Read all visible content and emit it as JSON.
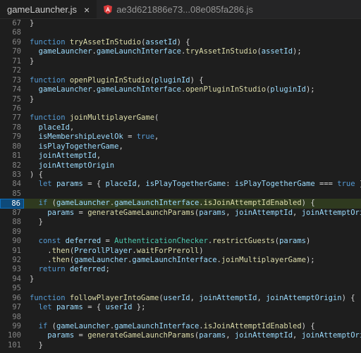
{
  "tabs": [
    {
      "label": "gameLauncher.js",
      "active": true
    },
    {
      "label": "ae3d621886e73...08e085fa286.js",
      "active": false
    }
  ],
  "close_glyph": "×",
  "highlighted_line": 86,
  "lines": [
    {
      "n": "67",
      "t": [
        [
          "}",
          "br"
        ]
      ]
    },
    {
      "n": "68",
      "t": []
    },
    {
      "n": "69",
      "t": [
        [
          "function ",
          "kw"
        ],
        [
          "tryAssetInStudio",
          "fn"
        ],
        [
          "(",
          "br"
        ],
        [
          "assetId",
          "var"
        ],
        [
          ") {",
          "br"
        ]
      ]
    },
    {
      "n": "70",
      "t": [
        [
          "  ",
          "br"
        ],
        [
          "gameLauncher",
          "var"
        ],
        [
          ".",
          "br"
        ],
        [
          "gameLaunchInterface",
          "var"
        ],
        [
          ".",
          "br"
        ],
        [
          "tryAssetInStudio",
          "fn"
        ],
        [
          "(",
          "br"
        ],
        [
          "assetId",
          "var"
        ],
        [
          ");",
          "br"
        ]
      ]
    },
    {
      "n": "71",
      "t": [
        [
          "}",
          "br"
        ]
      ]
    },
    {
      "n": "72",
      "t": []
    },
    {
      "n": "73",
      "t": [
        [
          "function ",
          "kw"
        ],
        [
          "openPluginInStudio",
          "fn"
        ],
        [
          "(",
          "br"
        ],
        [
          "pluginId",
          "var"
        ],
        [
          ") {",
          "br"
        ]
      ]
    },
    {
      "n": "74",
      "t": [
        [
          "  ",
          "br"
        ],
        [
          "gameLauncher",
          "var"
        ],
        [
          ".",
          "br"
        ],
        [
          "gameLaunchInterface",
          "var"
        ],
        [
          ".",
          "br"
        ],
        [
          "openPluginInStudio",
          "fn"
        ],
        [
          "(",
          "br"
        ],
        [
          "pluginId",
          "var"
        ],
        [
          ");",
          "br"
        ]
      ]
    },
    {
      "n": "75",
      "t": [
        [
          "}",
          "br"
        ]
      ]
    },
    {
      "n": "76",
      "t": []
    },
    {
      "n": "77",
      "t": [
        [
          "function ",
          "kw"
        ],
        [
          "joinMultiplayerGame",
          "fn"
        ],
        [
          "(",
          "br"
        ]
      ]
    },
    {
      "n": "78",
      "t": [
        [
          "  ",
          "br"
        ],
        [
          "placeId",
          "var"
        ],
        [
          ",",
          "br"
        ]
      ]
    },
    {
      "n": "79",
      "t": [
        [
          "  ",
          "br"
        ],
        [
          "isMembershipLevelOk",
          "var"
        ],
        [
          " = ",
          "br"
        ],
        [
          "true",
          "kw"
        ],
        [
          ",",
          "br"
        ]
      ]
    },
    {
      "n": "80",
      "t": [
        [
          "  ",
          "br"
        ],
        [
          "isPlayTogetherGame",
          "var"
        ],
        [
          ",",
          "br"
        ]
      ]
    },
    {
      "n": "81",
      "t": [
        [
          "  ",
          "br"
        ],
        [
          "joinAttemptId",
          "var"
        ],
        [
          ",",
          "br"
        ]
      ]
    },
    {
      "n": "82",
      "t": [
        [
          "  ",
          "br"
        ],
        [
          "joinAttemptOrigin",
          "var"
        ]
      ]
    },
    {
      "n": "83",
      "t": [
        [
          ") {",
          "br"
        ]
      ]
    },
    {
      "n": "84",
      "t": [
        [
          "  ",
          "br"
        ],
        [
          "let ",
          "kw"
        ],
        [
          "params",
          "var"
        ],
        [
          " = { ",
          "br"
        ],
        [
          "placeId",
          "var"
        ],
        [
          ", ",
          "br"
        ],
        [
          "isPlayTogetherGame",
          "var"
        ],
        [
          ": ",
          "br"
        ],
        [
          "isPlayTogetherGame",
          "var"
        ],
        [
          " === ",
          "br"
        ],
        [
          "true",
          "kw"
        ],
        [
          " };",
          "br"
        ]
      ]
    },
    {
      "n": "85",
      "t": []
    },
    {
      "n": "86",
      "t": [
        [
          "  ",
          "br"
        ],
        [
          "if",
          "kw"
        ],
        [
          " (",
          "br"
        ],
        [
          "gameLauncher",
          "var"
        ],
        [
          ".",
          "br"
        ],
        [
          "gameLaunchInterface",
          "var"
        ],
        [
          ".",
          "br"
        ],
        [
          "isJoinAttemptIdEnabled",
          "fn"
        ],
        [
          ") {",
          "br"
        ]
      ]
    },
    {
      "n": "87",
      "t": [
        [
          "    ",
          "br"
        ],
        [
          "params",
          "var"
        ],
        [
          " = ",
          "br"
        ],
        [
          "generateGameLaunchParams",
          "fn"
        ],
        [
          "(",
          "br"
        ],
        [
          "params",
          "var"
        ],
        [
          ", ",
          "br"
        ],
        [
          "joinAttemptId",
          "var"
        ],
        [
          ", ",
          "br"
        ],
        [
          "joinAttemptOrigin",
          "var"
        ],
        [
          ");",
          "br"
        ]
      ]
    },
    {
      "n": "88",
      "t": [
        [
          "  }",
          "br"
        ]
      ]
    },
    {
      "n": "89",
      "t": []
    },
    {
      "n": "90",
      "t": [
        [
          "  ",
          "br"
        ],
        [
          "const ",
          "kw"
        ],
        [
          "deferred",
          "var"
        ],
        [
          " = ",
          "br"
        ],
        [
          "AuthenticationChecker",
          "cls"
        ],
        [
          ".",
          "br"
        ],
        [
          "restrictGuests",
          "fn"
        ],
        [
          "(",
          "br"
        ],
        [
          "params",
          "var"
        ],
        [
          ")",
          "br"
        ]
      ]
    },
    {
      "n": "91",
      "t": [
        [
          "    .",
          "br"
        ],
        [
          "then",
          "fn"
        ],
        [
          "(",
          "br"
        ],
        [
          "PrerollPlayer",
          "var"
        ],
        [
          ".",
          "br"
        ],
        [
          "waitForPreroll",
          "fn"
        ],
        [
          ")",
          "br"
        ]
      ]
    },
    {
      "n": "92",
      "t": [
        [
          "    .",
          "br"
        ],
        [
          "then",
          "fn"
        ],
        [
          "(",
          "br"
        ],
        [
          "gameLauncher",
          "var"
        ],
        [
          ".",
          "br"
        ],
        [
          "gameLaunchInterface",
          "var"
        ],
        [
          ".",
          "br"
        ],
        [
          "joinMultiplayerGame",
          "fn"
        ],
        [
          ");",
          "br"
        ]
      ]
    },
    {
      "n": "93",
      "t": [
        [
          "  ",
          "br"
        ],
        [
          "return ",
          "kw"
        ],
        [
          "deferred",
          "var"
        ],
        [
          ";",
          "br"
        ]
      ]
    },
    {
      "n": "94",
      "t": [
        [
          "}",
          "br"
        ]
      ]
    },
    {
      "n": "95",
      "t": []
    },
    {
      "n": "96",
      "t": [
        [
          "function ",
          "kw"
        ],
        [
          "followPlayerIntoGame",
          "fn"
        ],
        [
          "(",
          "br"
        ],
        [
          "userId",
          "var"
        ],
        [
          ", ",
          "br"
        ],
        [
          "joinAttemptId",
          "var"
        ],
        [
          ", ",
          "br"
        ],
        [
          "joinAttemptOrigin",
          "var"
        ],
        [
          ") {",
          "br"
        ]
      ]
    },
    {
      "n": "97",
      "t": [
        [
          "  ",
          "br"
        ],
        [
          "let ",
          "kw"
        ],
        [
          "params",
          "var"
        ],
        [
          " = { ",
          "br"
        ],
        [
          "userId",
          "var"
        ],
        [
          " };",
          "br"
        ]
      ]
    },
    {
      "n": "98",
      "t": []
    },
    {
      "n": "99",
      "t": [
        [
          "  ",
          "br"
        ],
        [
          "if",
          "kw"
        ],
        [
          " (",
          "br"
        ],
        [
          "gameLauncher",
          "var"
        ],
        [
          ".",
          "br"
        ],
        [
          "gameLaunchInterface",
          "var"
        ],
        [
          ".",
          "br"
        ],
        [
          "isJoinAttemptIdEnabled",
          "fn"
        ],
        [
          ") {",
          "br"
        ]
      ]
    },
    {
      "n": "100",
      "t": [
        [
          "    ",
          "br"
        ],
        [
          "params",
          "var"
        ],
        [
          " = ",
          "br"
        ],
        [
          "generateGameLaunchParams",
          "fn"
        ],
        [
          "(",
          "br"
        ],
        [
          "params",
          "var"
        ],
        [
          ", ",
          "br"
        ],
        [
          "joinAttemptId",
          "var"
        ],
        [
          ", ",
          "br"
        ],
        [
          "joinAttemptOrigin",
          "var"
        ],
        [
          ");",
          "br"
        ]
      ]
    },
    {
      "n": "101",
      "t": [
        [
          "  }",
          "br"
        ]
      ]
    }
  ]
}
